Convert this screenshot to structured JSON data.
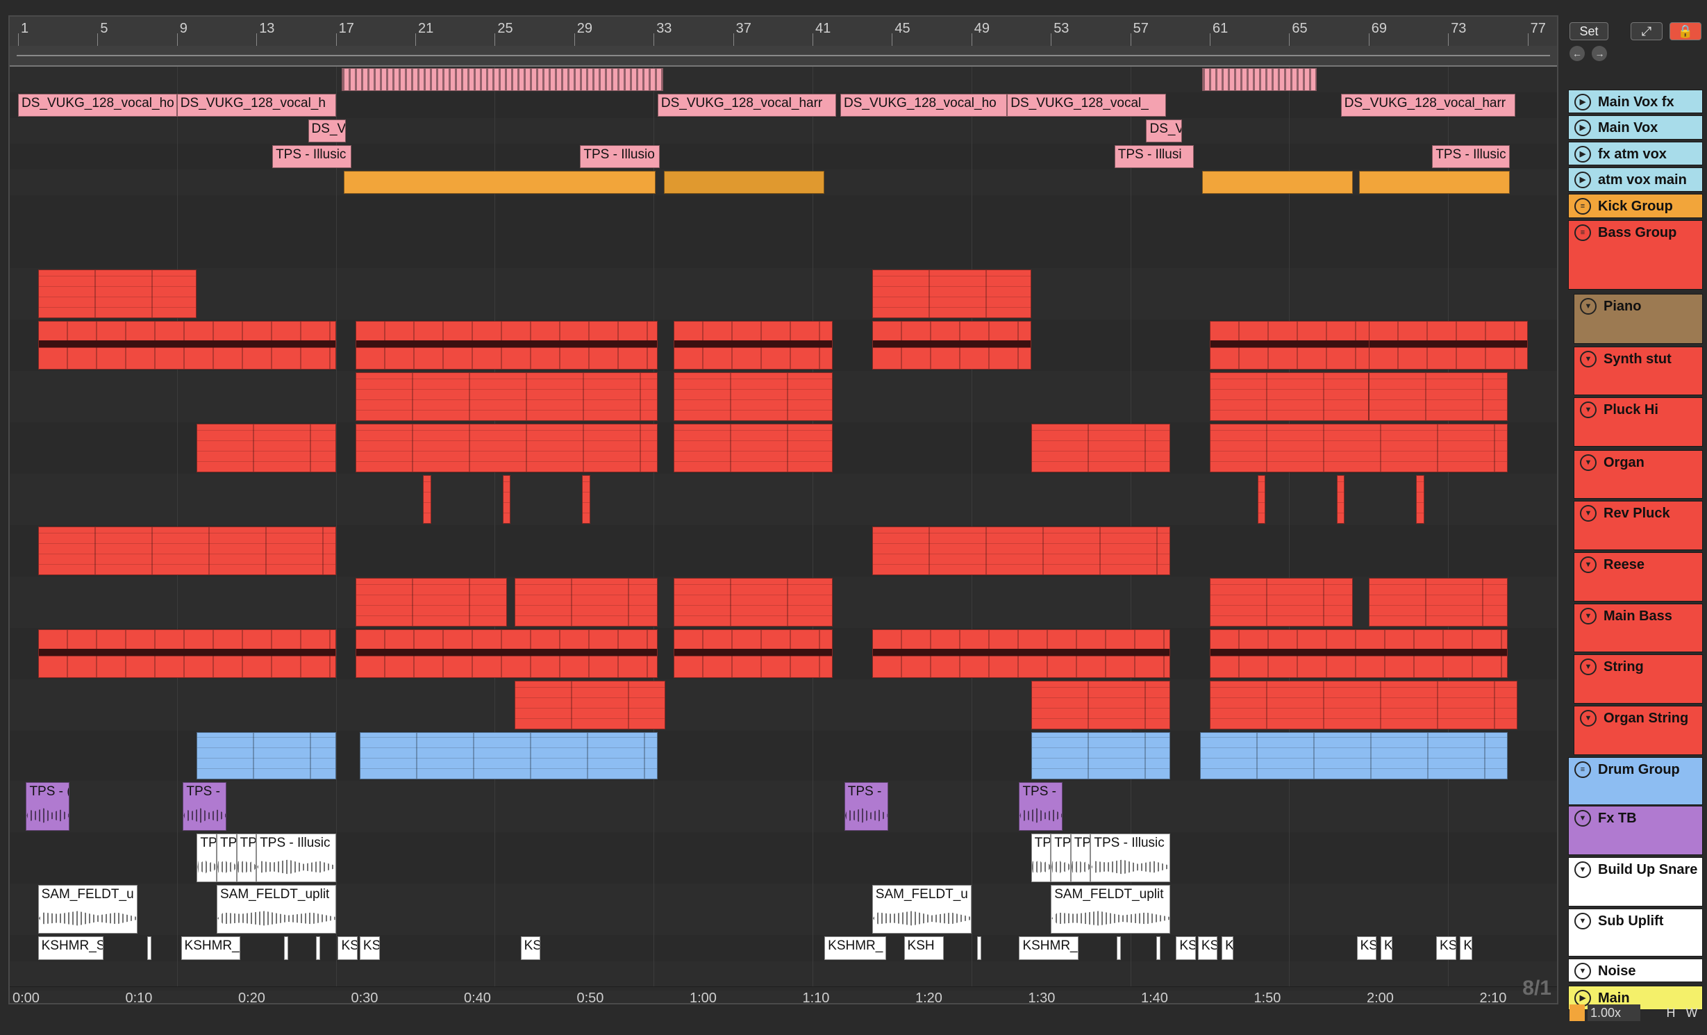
{
  "ruler": {
    "bars": [
      "1",
      "5",
      "9",
      "13",
      "17",
      "21",
      "25",
      "29",
      "33",
      "37",
      "41",
      "45",
      "49",
      "53",
      "57",
      "61",
      "65",
      "69",
      "73",
      "77"
    ]
  },
  "timeline": {
    "times": [
      "0:00",
      "0:10",
      "0:20",
      "0:30",
      "0:40",
      "0:50",
      "1:00",
      "1:10",
      "1:20",
      "1:30",
      "1:40",
      "1:50",
      "2:00",
      "2:10"
    ]
  },
  "grid_indicator": "8/1",
  "toolbar": {
    "set_label": "Set",
    "expand_icon": "expand-icon",
    "lock_icon": "lock-icon"
  },
  "status": {
    "zoom": "1.00x",
    "h_label": "H",
    "w_label": "W"
  },
  "tracks": [
    {
      "name": "Main Vox fx",
      "color": "#a8dcea",
      "icon": "play-icon"
    },
    {
      "name": "Main Vox",
      "color": "#a8dcea",
      "icon": "play-icon"
    },
    {
      "name": "fx atm vox",
      "color": "#a8dcea",
      "icon": "play-icon"
    },
    {
      "name": "atm vox main",
      "color": "#a8dcea",
      "icon": "play-icon"
    },
    {
      "name": "Kick Group",
      "color": "#f2a53a",
      "icon": "group-icon"
    },
    {
      "name": "Bass Group",
      "color": "#f04a40",
      "icon": "group-icon"
    },
    {
      "name": "Piano",
      "color": "#9c7a52",
      "icon": "fold-icon"
    },
    {
      "name": "Synth stut",
      "color": "#f04a40",
      "icon": "fold-icon"
    },
    {
      "name": "Pluck Hi",
      "color": "#f04a40",
      "icon": "fold-icon"
    },
    {
      "name": "Organ",
      "color": "#f04a40",
      "icon": "fold-icon"
    },
    {
      "name": "Rev Pluck",
      "color": "#f04a40",
      "icon": "fold-icon"
    },
    {
      "name": "Reese",
      "color": "#f04a40",
      "icon": "fold-icon"
    },
    {
      "name": "Main Bass",
      "color": "#f04a40",
      "icon": "fold-icon"
    },
    {
      "name": "String",
      "color": "#f04a40",
      "icon": "fold-icon"
    },
    {
      "name": "Organ String",
      "color": "#f04a40",
      "icon": "fold-icon"
    },
    {
      "name": "Drum Group",
      "color": "#8dbdf2",
      "icon": "group-icon"
    },
    {
      "name": "Fx TB",
      "color": "#b07ad0",
      "icon": "fold-icon"
    },
    {
      "name": "Build Up Snare",
      "color": "#ffffff",
      "icon": "fold-icon"
    },
    {
      "name": "Sub Uplift",
      "color": "#ffffff",
      "icon": "fold-icon"
    },
    {
      "name": "Noise",
      "color": "#ffffff",
      "icon": "fold-icon"
    },
    {
      "name": "Main",
      "color": "#f4f06a",
      "icon": "play-icon"
    }
  ],
  "clips": {
    "main_vox": [
      "DS_VUKG_128_vocal_ho",
      "DS_VUKG_128_vocal_h",
      "DS_VUKG_128_vocal_harr",
      "DS_VUKG_128_vocal_ho",
      "DS_VUKG_128_vocal_",
      "DS_VUKG_128_vocal_harr"
    ],
    "fx_atm": [
      "DS_V",
      "DS_V"
    ],
    "atm_main": [
      "TPS - Illusic",
      "TPS - Illusio",
      "TPS - Illusi",
      "TPS - Illusic"
    ],
    "fx_tb": [
      "TPS - (",
      "TPS -",
      "TPS -",
      "TPS -"
    ],
    "build_up": [
      "TP",
      "TP",
      "TP",
      "TPS - Illusic",
      "TP",
      "TP",
      "TP",
      "TPS - Illusic"
    ],
    "sub_uplift": [
      "SAM_FELDT_u",
      "SAM_FELDT_uplit",
      "SAM_FELDT_u",
      "SAM_FELDT_uplit"
    ],
    "noise": [
      "KSHMR_S",
      "KSHMR_",
      "KS",
      "KS",
      "KS",
      "KSHMR_",
      "KSH",
      "KSHMR_",
      "KS",
      "KS",
      "K",
      "KS",
      "K",
      "KS",
      "K"
    ]
  }
}
